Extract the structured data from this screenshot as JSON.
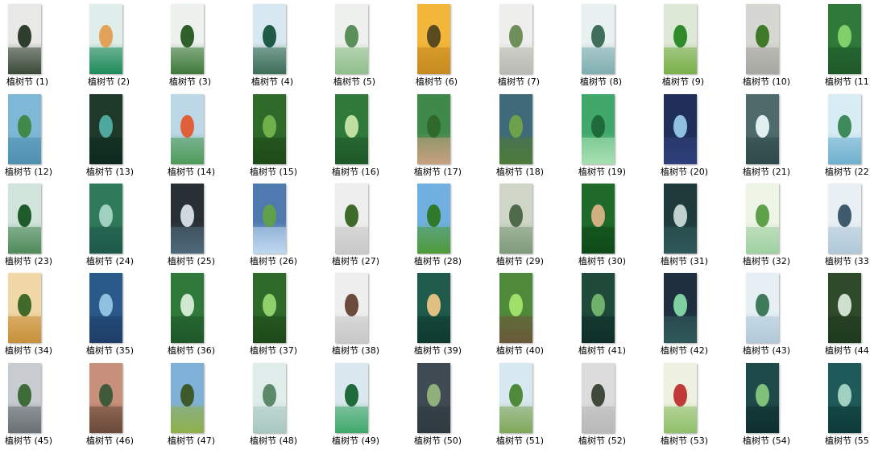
{
  "files": [
    {
      "label": "植树节 (1)",
      "bg": "#e8e8e6",
      "accent": "#3b4a3a",
      "art": "#2f3d2c"
    },
    {
      "label": "植树节 (2)",
      "bg": "#dfeeea",
      "accent": "#1f8a5a",
      "art": "#e2a25a"
    },
    {
      "label": "植树节 (3)",
      "bg": "#eef2ee",
      "accent": "#3f7a3a",
      "art": "#2f5f2a"
    },
    {
      "label": "植树节 (4)",
      "bg": "#d8e8f0",
      "accent": "#3c6e58",
      "art": "#1f5a46"
    },
    {
      "label": "植树节 (5)",
      "bg": "#eef0ee",
      "accent": "#8fbf8a",
      "art": "#5a8f5a"
    },
    {
      "label": "植树节 (6)",
      "bg": "#f2b63a",
      "accent": "#c68a20",
      "art": "#5a4a20"
    },
    {
      "label": "植树节 (7)",
      "bg": "#eeeeec",
      "accent": "#b9b9b3",
      "art": "#6f8f5a"
    },
    {
      "label": "植树节 (8)",
      "bg": "#e8f0f0",
      "accent": "#7faeb0",
      "art": "#3f6f5a"
    },
    {
      "label": "植树节 (9)",
      "bg": "#dde8d6",
      "accent": "#7ab04a",
      "art": "#2f8a2a"
    },
    {
      "label": "植树节 (10)",
      "bg": "#d6d6d2",
      "accent": "#a8a8a2",
      "art": "#3f7a2a"
    },
    {
      "label": "植树节 (11)",
      "bg": "#2f7a3a",
      "accent": "#1f5a2a",
      "art": "#7fcf6a"
    },
    {
      "label": "植树节 (12)",
      "bg": "#7fb8d6",
      "accent": "#4f8fb0",
      "art": "#3f8a4a"
    },
    {
      "label": "植树节 (13)",
      "bg": "#1f3a2a",
      "accent": "#0f2a1f",
      "art": "#4fa8a0"
    },
    {
      "label": "植树节 (14)",
      "bg": "#bcd8e6",
      "accent": "#4f9a5a",
      "art": "#e0603a"
    },
    {
      "label": "植树节 (15)",
      "bg": "#2f6a2a",
      "accent": "#1f4a1a",
      "art": "#6fb04a"
    },
    {
      "label": "植树节 (16)",
      "bg": "#2f7a3a",
      "accent": "#1f5a2a",
      "art": "#bfe0a0"
    },
    {
      "label": "植树节 (17)",
      "bg": "#3f8a4a",
      "accent": "#c8a080",
      "art": "#2f6a2a"
    },
    {
      "label": "植树节 (18)",
      "bg": "#3f6a7a",
      "accent": "#4f7a3a",
      "art": "#6fa04a"
    },
    {
      "label": "植树节 (19)",
      "bg": "#3fa86a",
      "accent": "#a8e0b0",
      "art": "#1f6a3a"
    },
    {
      "label": "植树节 (20)",
      "bg": "#1f2f5a",
      "accent": "#2f3f7a",
      "art": "#8fc0e0"
    },
    {
      "label": "植树节 (21)",
      "bg": "#4f6a6a",
      "accent": "#2f4a4a",
      "art": "#e0f0f0"
    },
    {
      "label": "植树节 (22)",
      "bg": "#d8ecf4",
      "accent": "#6fb0d0",
      "art": "#3f8a5a"
    },
    {
      "label": "植树节 (23)",
      "bg": "#d0e4dc",
      "accent": "#4f8a5a",
      "art": "#1f5a2a"
    },
    {
      "label": "植树节 (24)",
      "bg": "#2f7a5a",
      "accent": "#1f5a4a",
      "art": "#9fd0c0"
    },
    {
      "label": "植树节 (25)",
      "bg": "#2a2f35",
      "accent": "#4f6a7a",
      "art": "#d0d8e0"
    },
    {
      "label": "植树节 (26)",
      "bg": "#4f7ab0",
      "accent": "#bfd8f0",
      "art": "#5fa04a"
    },
    {
      "label": "植树节 (27)",
      "bg": "#eeeeee",
      "accent": "#c8c8c8",
      "art": "#3f6a2a"
    },
    {
      "label": "植树节 (28)",
      "bg": "#6fb0e0",
      "accent": "#4f9a3a",
      "art": "#2f7a2a"
    },
    {
      "label": "植树节 (29)",
      "bg": "#cfd6c8",
      "accent": "#7f9a7a",
      "art": "#4f6a4a"
    },
    {
      "label": "植树节 (30)",
      "bg": "#1f6a2a",
      "accent": "#0f4a1a",
      "art": "#d0b080"
    },
    {
      "label": "植树节 (31)",
      "bg": "#1f3a3a",
      "accent": "#2f5a5a",
      "art": "#c0d0d0"
    },
    {
      "label": "植树节 (32)",
      "bg": "#eef4e6",
      "accent": "#9fd0a0",
      "art": "#5fa04a"
    },
    {
      "label": "植树节 (33)",
      "bg": "#e8f0f4",
      "accent": "#b0c8d8",
      "art": "#3f5a6a"
    },
    {
      "label": "植树节 (34)",
      "bg": "#f0d8a8",
      "accent": "#c8903a",
      "art": "#3f6a2a"
    },
    {
      "label": "植树节 (35)",
      "bg": "#2a5a8a",
      "accent": "#1f3f6a",
      "art": "#8fc0e0"
    },
    {
      "label": "植树节 (36)",
      "bg": "#2f7a3a",
      "accent": "#1f5a2a",
      "art": "#cfe8cf"
    },
    {
      "label": "植树节 (37)",
      "bg": "#2f6a2a",
      "accent": "#1f4a1a",
      "art": "#8fd06a"
    },
    {
      "label": "植树节 (38)",
      "bg": "#eeeeee",
      "accent": "#c8c8c8",
      "art": "#6a4a3a"
    },
    {
      "label": "植树节 (39)",
      "bg": "#1f5a4a",
      "accent": "#0f3a2f",
      "art": "#e0c080"
    },
    {
      "label": "植树节 (40)",
      "bg": "#4f8a3a",
      "accent": "#6a5a3a",
      "art": "#9fe06a"
    },
    {
      "label": "植树节 (41)",
      "bg": "#1f4a3a",
      "accent": "#0f2f2a",
      "art": "#6fb06a"
    },
    {
      "label": "植树节 (42)",
      "bg": "#1f2f3f",
      "accent": "#2f5a5a",
      "art": "#7fd0a0"
    },
    {
      "label": "植树节 (43)",
      "bg": "#e6f0f4",
      "accent": "#b0c8d8",
      "art": "#3f7a5a"
    },
    {
      "label": "植树节 (44)",
      "bg": "#2f4a2a",
      "accent": "#1f3a1f",
      "art": "#cfe0cf"
    },
    {
      "label": "植树节 (45)",
      "bg": "#c8ccd0",
      "accent": "#6a6f74",
      "art": "#3f6a3a"
    },
    {
      "label": "植树节 (46)",
      "bg": "#c8907a",
      "accent": "#6a4a3a",
      "art": "#3f5a3a"
    },
    {
      "label": "植树节 (47)",
      "bg": "#7fb0d8",
      "accent": "#8fb04a",
      "art": "#3f5a2a"
    },
    {
      "label": "植树节 (48)",
      "bg": "#e0ecea",
      "accent": "#a8c8c0",
      "art": "#5a8a6a"
    },
    {
      "label": "植树节 (49)",
      "bg": "#dce8f0",
      "accent": "#3fa86a",
      "art": "#1f6a3a"
    },
    {
      "label": "植树节 (50)",
      "bg": "#3f4a52",
      "accent": "#2f3a42",
      "art": "#8fb07a"
    },
    {
      "label": "植树节 (51)",
      "bg": "#d8e8f0",
      "accent": "#7fa85a",
      "art": "#4f8a3a"
    },
    {
      "label": "植树节 (52)",
      "bg": "#dcdcdc",
      "accent": "#b8b8b8",
      "art": "#3f4a3a"
    },
    {
      "label": "植树节 (53)",
      "bg": "#eef0e0",
      "accent": "#8fc06a",
      "art": "#c03a3a"
    },
    {
      "label": "植树节 (54)",
      "bg": "#1f4a4a",
      "accent": "#0f2f2f",
      "art": "#7fc07a"
    },
    {
      "label": "植树节 (55)",
      "bg": "#1f5a5a",
      "accent": "#0f3a3a",
      "art": "#9fd0c0"
    }
  ]
}
